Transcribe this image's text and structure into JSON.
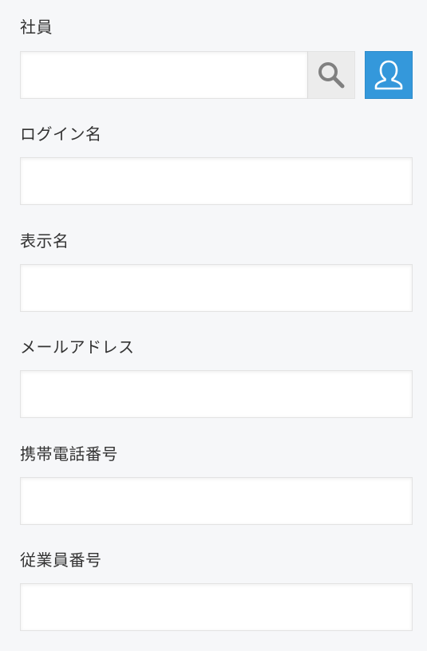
{
  "fields": {
    "employee": {
      "label": "社員",
      "value": "",
      "placeholder": ""
    },
    "login_name": {
      "label": "ログイン名",
      "value": "",
      "placeholder": ""
    },
    "display_name": {
      "label": "表示名",
      "value": "",
      "placeholder": ""
    },
    "email": {
      "label": "メールアドレス",
      "value": "",
      "placeholder": ""
    },
    "mobile_phone": {
      "label": "携帯電話番号",
      "value": "",
      "placeholder": ""
    },
    "employee_number": {
      "label": "従業員番号",
      "value": "",
      "placeholder": ""
    }
  },
  "icons": {
    "search": "search-icon",
    "user": "user-icon"
  },
  "colors": {
    "background": "#f6f7f9",
    "accent": "#3498db",
    "search_button": "#ececec",
    "text": "#333333"
  }
}
